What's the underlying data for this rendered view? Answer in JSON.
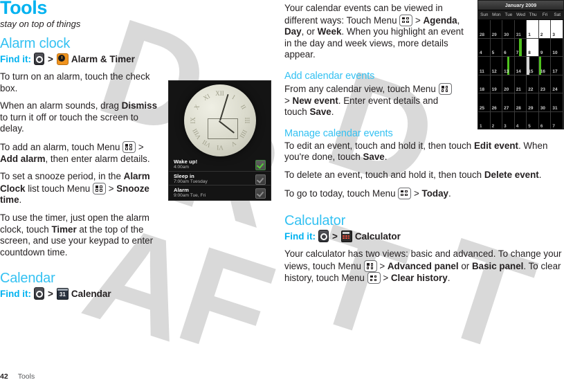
{
  "chapter": {
    "title": "Tools",
    "subtitle": "stay on top of things"
  },
  "watermark": {
    "text": "DRAFT"
  },
  "footer": {
    "page_number": "42",
    "section": "Tools"
  },
  "left_column": {
    "alarm_section": {
      "heading": "Alarm clock",
      "find_it": {
        "label": "Find it:",
        "separator": ">",
        "launcher_icon": "launcher-icon",
        "app_icon": "alarm-clock-icon",
        "app_name": "Alarm & Timer"
      },
      "paragraphs": [
        {
          "id": "p1",
          "html": "To turn on an alarm, touch the check box."
        },
        {
          "id": "p2",
          "html": "When an alarm sounds, drag <b>Dismiss</b> to turn it off or touch the screen to delay."
        },
        {
          "id": "p3",
          "html": "To add an alarm, touch Menu <span class=\"ico-menu\" data-name=\"menu-key-icon\"><i class=\"a\"></i><i class=\"b\"></i><i class=\"c\"></i><i class=\"d\"></i></span> > <b>Add alarm</b>, then enter alarm details."
        },
        {
          "id": "p4",
          "html": "To set a snooze period, in the <b>Alarm Clock</b> list touch Menu <span class=\"ico-menu\" data-name=\"menu-key-icon\"><i class=\"a\"></i><i class=\"b\"></i><i class=\"c\"></i><i class=\"d\"></i></span> > <b>Snooze time</b>."
        },
        {
          "id": "p5",
          "html": "To use the timer, just open the alarm clock, touch <b>Timer</b> at the top of the screen, and use your keypad to enter countdown time."
        }
      ]
    },
    "calendar_section": {
      "heading": "Calendar",
      "find_it": {
        "label": "Find it:",
        "separator": ">",
        "launcher_icon": "launcher-icon",
        "app_icon": "calendar-icon",
        "app_icon_text": "31",
        "app_name": "Calendar"
      }
    }
  },
  "right_column": {
    "calendar_intro": {
      "html": "Your calendar events can be viewed in different ways: Touch Menu <span class=\"ico-menu\" data-name=\"menu-key-icon\"><i class=\"a\"></i><i class=\"b\"></i><i class=\"c\"></i><i class=\"d\"></i></span> > <b>Agenda</b>, <b>Day</b>, or <b>Week</b>. When you highlight an event in the day and week views, more details appear."
    },
    "add_events": {
      "heading": "Add calendar events",
      "html": "From any calendar view, touch Menu <span class=\"ico-menu\" data-name=\"menu-key-icon\"><i class=\"a\"></i><i class=\"b\"></i><i class=\"c\"></i><i class=\"d\"></i></span> > <b>New event</b>. Enter event details and touch <b>Save</b>."
    },
    "manage_events": {
      "heading": "Manage calendar events",
      "paragraphs": [
        {
          "id": "m1",
          "html": "To edit an event, touch and hold it, then touch <b>Edit event</b>. When you're done, touch <b>Save</b>."
        },
        {
          "id": "m2",
          "html": "To delete an event, touch and hold it, then touch <b>Delete event</b>."
        },
        {
          "id": "m3",
          "html": "To go to today, touch Menu <span class=\"ico-menu\" data-name=\"menu-key-icon\"><i class=\"a\"></i><i class=\"b\"></i><i class=\"c\"></i><i class=\"d\"></i></span> > <b>Today</b>."
        }
      ]
    },
    "calculator_section": {
      "heading": "Calculator",
      "find_it": {
        "label": "Find it:",
        "separator": ">",
        "launcher_icon": "launcher-icon",
        "app_icon": "calculator-icon",
        "app_name": "Calculator"
      },
      "html": "Your calculator has two views: basic and advanced. To change your views, touch Menu <span class=\"ico-menu\" data-name=\"menu-key-icon\"><i class=\"a\"></i><i class=\"b\"></i><i class=\"c\"></i><i class=\"d\"></i></span> > <b>Advanced panel</b> or <b>Basic panel</b>. To clear history, touch Menu <span class=\"ico-menu\" data-name=\"menu-key-icon\"><i class=\"a\"></i><i class=\"b\"></i><i class=\"c\"></i><i class=\"d\"></i></span> > <b>Clear history</b>."
    }
  },
  "alarm_screenshot": {
    "clock_numerals": [
      "I",
      "II",
      "III",
      "IIII",
      "V",
      "VI",
      "VII",
      "VIII",
      "IX",
      "X",
      "XI",
      "XII"
    ],
    "alarms": [
      {
        "name": "Wake up!",
        "time": "4:00am",
        "enabled": true
      },
      {
        "name": "Sleep in",
        "time": "7:00am Tuesday",
        "enabled": false
      },
      {
        "name": "Alarm",
        "time": "9:00am Tue, Fri",
        "enabled": false
      }
    ]
  },
  "calendar_screenshot": {
    "month_title": "January 2009",
    "day_headers": [
      "Sun",
      "Mon",
      "Tue",
      "Wed",
      "Thu",
      "Fri",
      "Sat"
    ],
    "weeks": [
      [
        {
          "d": "28",
          "dim": true
        },
        {
          "d": "29",
          "dim": true
        },
        {
          "d": "30",
          "dim": true
        },
        {
          "d": "31",
          "dim": true
        },
        {
          "d": "1",
          "cur": true
        },
        {
          "d": "2",
          "cur": true
        },
        {
          "d": "3",
          "cur": true
        }
      ],
      [
        {
          "d": "4"
        },
        {
          "d": "5"
        },
        {
          "d": "6"
        },
        {
          "d": "7",
          "ev": "mid"
        },
        {
          "d": "8",
          "cur": true
        },
        {
          "d": "9"
        },
        {
          "d": "10"
        }
      ],
      [
        {
          "d": "11"
        },
        {
          "d": "12"
        },
        {
          "d": "13",
          "ev": "mid"
        },
        {
          "d": "14"
        },
        {
          "d": "15",
          "ev": "left-grey"
        },
        {
          "d": "16",
          "ev": "left"
        },
        {
          "d": "17"
        }
      ],
      [
        {
          "d": "18"
        },
        {
          "d": "19"
        },
        {
          "d": "20"
        },
        {
          "d": "21"
        },
        {
          "d": "22"
        },
        {
          "d": "23"
        },
        {
          "d": "24"
        }
      ],
      [
        {
          "d": "25"
        },
        {
          "d": "26"
        },
        {
          "d": "27"
        },
        {
          "d": "28"
        },
        {
          "d": "29"
        },
        {
          "d": "30"
        },
        {
          "d": "31"
        }
      ],
      [
        {
          "d": "1",
          "dim": true
        },
        {
          "d": "2",
          "dim": true
        },
        {
          "d": "3",
          "dim": true
        },
        {
          "d": "4",
          "dim": true
        },
        {
          "d": "5",
          "dim": true
        },
        {
          "d": "6",
          "dim": true
        },
        {
          "d": "7",
          "dim": true
        }
      ]
    ],
    "accent_event_color": "#4fc21e"
  }
}
